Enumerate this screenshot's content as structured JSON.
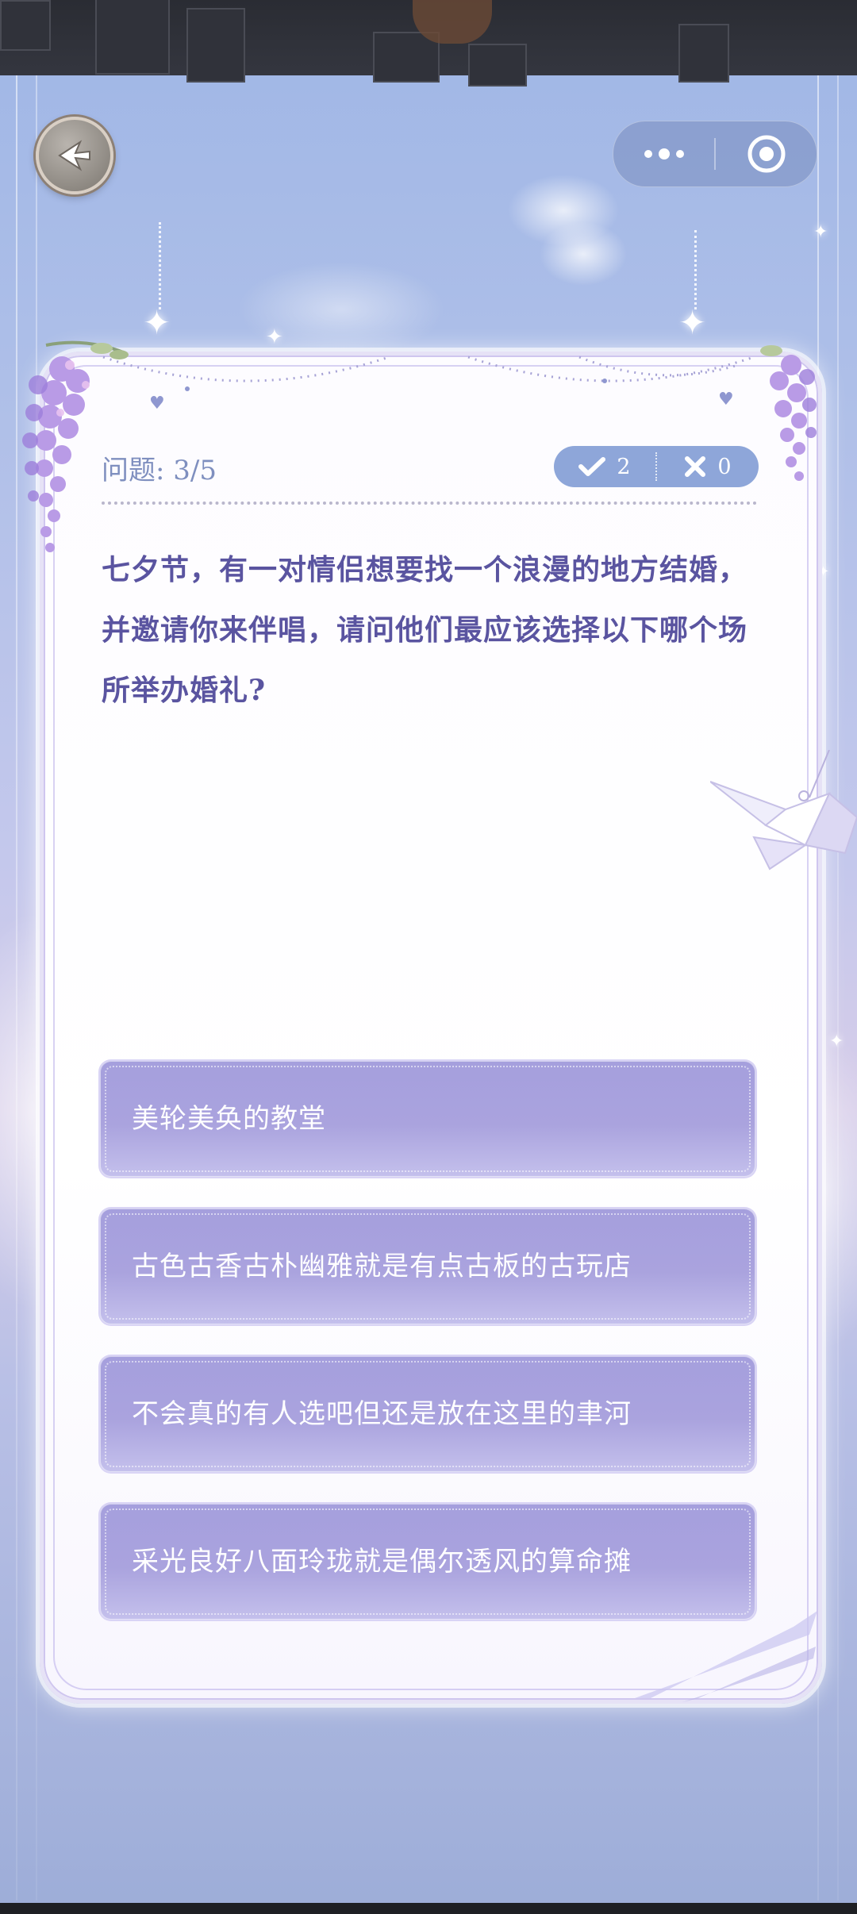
{
  "header": {
    "back_icon": "back-arrow-icon",
    "capsule": {
      "more_icon": "more-dots-icon",
      "close_icon": "target-circle-icon"
    }
  },
  "quiz": {
    "progress_label": "问题: 3/5",
    "correct_count": "2",
    "wrong_count": "0",
    "question": "七夕节，有一对情侣想要找一个浪漫的地方结婚，并邀请你来伴唱，请问他们最应该选择以下哪个场所举办婚礼?",
    "options": [
      {
        "label": "美轮美奂的教堂"
      },
      {
        "label": "古色古香古朴幽雅就是有点古板的古玩店"
      },
      {
        "label": "不会真的有人选吧但还是放在这里的聿河"
      },
      {
        "label": "采光良好八面玲珑就是偶尔透风的算命摊"
      }
    ]
  },
  "colors": {
    "accent": "#a59fdd",
    "question_text": "#5a54a0",
    "score_pill": "#8ea6d9",
    "label_text": "#7f8fbf"
  }
}
